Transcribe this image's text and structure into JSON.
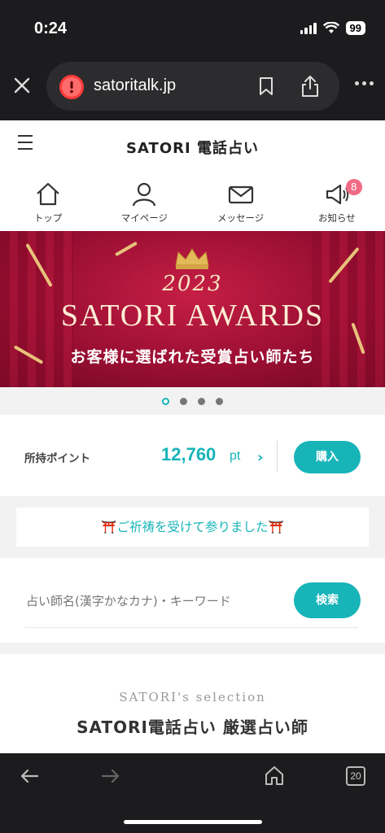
{
  "status_bar": {
    "time": "0:24",
    "battery": "99"
  },
  "browser": {
    "url": "satoritalk.jp"
  },
  "header": {
    "logo": "SATORI 電話占い"
  },
  "nav": [
    {
      "label": "トップ",
      "icon": "home-icon"
    },
    {
      "label": "マイページ",
      "icon": "user-icon"
    },
    {
      "label": "メッセージ",
      "icon": "mail-icon"
    },
    {
      "label": "お知らせ",
      "icon": "megaphone-icon",
      "badge": "8"
    }
  ],
  "banner": {
    "year": "2023",
    "title": "SATORI AWARDS",
    "subtitle": "お客様に選ばれた受賞占い師たち"
  },
  "carousel": {
    "pages": 4,
    "active": 0
  },
  "points": {
    "label": "所持ポイント",
    "value": "12,760",
    "unit": "pt",
    "buy_label": "購入"
  },
  "notice": {
    "text": "ご祈祷を受けて参りました",
    "torii": "⛩️"
  },
  "search": {
    "placeholder": "占い師名(漢字かなカナ)・キーワード",
    "button_label": "検索"
  },
  "selection": {
    "subtitle": "SATORI's selection",
    "title": "SATORI電話占い 厳選占い師"
  },
  "toolbar": {
    "tab_count": "20"
  },
  "colors": {
    "accent": "#17b4b8",
    "badge": "#f06b83",
    "banner": "#9b0f33"
  }
}
